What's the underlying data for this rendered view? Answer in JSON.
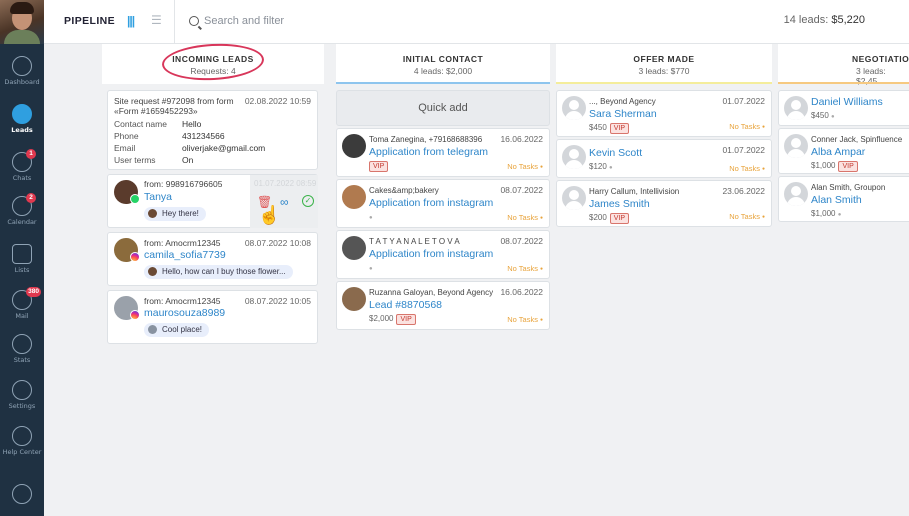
{
  "app": {
    "title": "PIPELINE",
    "search_placeholder": "Search and filter",
    "summary_leads": "14 leads:",
    "summary_amount": "$5,220"
  },
  "sidebar": [
    {
      "label": "Dashboard",
      "icon": "speedometer-icon",
      "badge": ""
    },
    {
      "label": "Leads",
      "icon": "leads-icon",
      "badge": ""
    },
    {
      "label": "Chats",
      "icon": "chat-icon",
      "badge": "1"
    },
    {
      "label": "Calendar",
      "icon": "checkmark-icon",
      "badge": "2"
    },
    {
      "label": "Lists",
      "icon": "list-icon",
      "badge": ""
    },
    {
      "label": "Mail",
      "icon": "mail-icon",
      "badge": "380"
    },
    {
      "label": "Stats",
      "icon": "stats-icon",
      "badge": ""
    },
    {
      "label": "Settings",
      "icon": "gear-icon",
      "badge": ""
    },
    {
      "label": "Help Center",
      "icon": "help-icon",
      "badge": ""
    }
  ],
  "columns": [
    {
      "title": "INCOMING LEADS",
      "sub": "Requests: 4",
      "color": "#ffffff"
    },
    {
      "title": "INITIAL CONTACT",
      "sub": "4 leads: $2,000",
      "color": "#8ec5ee"
    },
    {
      "title": "OFFER MADE",
      "sub": "3 leads: $770",
      "color": "#f4ed9b"
    },
    {
      "title": "NEGOTIATIO",
      "sub": "3 leads: $2,45",
      "color": "#f6c980"
    }
  ],
  "incoming": {
    "request": {
      "title": "Site request #972098 from form «Form #1659452293»",
      "date": "02.08.2022 10:59",
      "fields": [
        {
          "key": "Contact name",
          "value": "Hello"
        },
        {
          "key": "Phone",
          "value": "431234566"
        },
        {
          "key": "Email",
          "value": "oliverjake@gmail.com"
        },
        {
          "key": "User terms",
          "value": "On"
        }
      ]
    },
    "chats": [
      {
        "from": "from: 998916796605",
        "date": "01.07.2022 08:59",
        "name": "Tanya",
        "message": "Hey there!"
      },
      {
        "from": "from: Amocrm12345",
        "date": "08.07.2022 10:08",
        "name": "camila_sofia7739",
        "message": "Hello, how can I buy those flower..."
      },
      {
        "from": "from: Amocrm12345",
        "date": "08.07.2022 10:05",
        "name": "maurosouza8989",
        "message": "Cool place!"
      }
    ]
  },
  "initial": {
    "quick_add": "Quick add",
    "cards": [
      {
        "meta": "Toma Zanegina, +79168688396",
        "date": "16.06.2022",
        "name": "Application from telegram",
        "price": "",
        "vip": "VIP",
        "tasks": "No Tasks"
      },
      {
        "meta": "Cakes&amp;bakery",
        "date": "08.07.2022",
        "name": "Application from instagram",
        "price": "",
        "vip": "",
        "tasks": "No Tasks"
      },
      {
        "meta": "T A T Y A N A L E T O V A",
        "date": "08.07.2022",
        "name": "Application from instagram",
        "price": "",
        "vip": "",
        "tasks": "No Tasks"
      },
      {
        "meta": "Ruzanna Galoyan, Beyond Agency",
        "date": "16.06.2022",
        "name": "Lead #8870568",
        "price": "$2,000",
        "vip": "VIP",
        "tasks": "No Tasks"
      }
    ]
  },
  "offer": {
    "cards": [
      {
        "meta": "..., Beyond Agency",
        "date": "01.07.2022",
        "name": "Sara Sherman",
        "price": "$450",
        "vip": "VIP",
        "tasks": "No Tasks"
      },
      {
        "meta": "",
        "date": "01.07.2022",
        "name": "Kevin Scott",
        "price": "$120",
        "vip": "",
        "tasks": "No Tasks"
      },
      {
        "meta": "Harry Callum, Intellivision",
        "date": "23.06.2022",
        "name": "James Smith",
        "price": "$200",
        "vip": "VIP",
        "tasks": "No Tasks"
      }
    ]
  },
  "negotiation": {
    "cards": [
      {
        "meta": "",
        "name": "Daniel Williams",
        "price": "$450"
      },
      {
        "meta": "Conner Jack, Spinfluence",
        "name": "Alba Ampar",
        "price": "$1,000",
        "vip": "VIP"
      },
      {
        "meta": "Alan Smith, Groupon",
        "name": "Alan Smith",
        "price": "$1,000"
      }
    ]
  }
}
